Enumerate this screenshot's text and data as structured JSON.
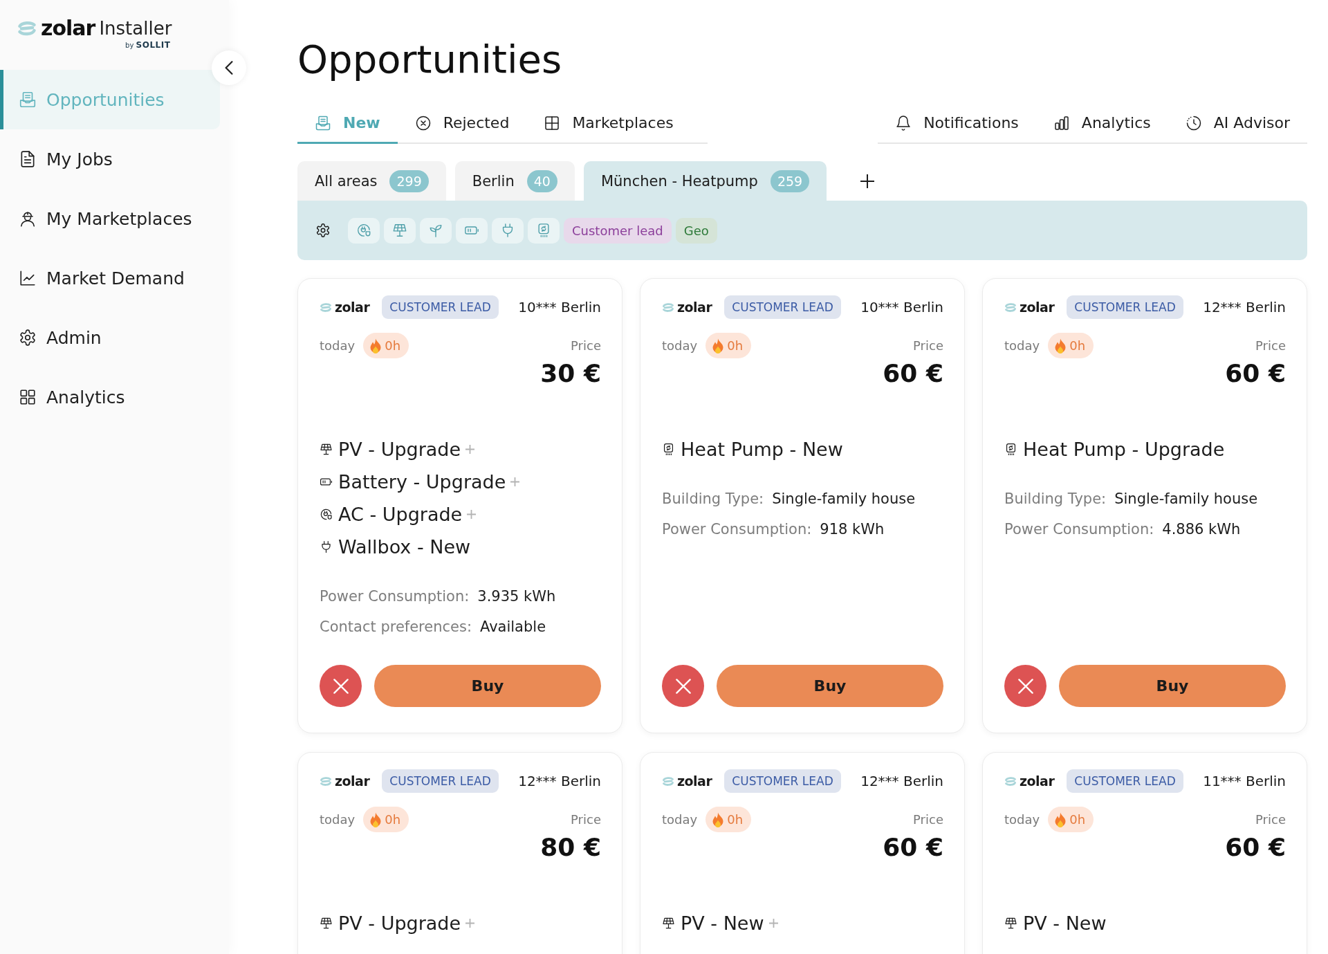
{
  "sidebar": {
    "logo": {
      "brand": "zolar",
      "product": "Installer",
      "byline": "by **SOLLIT**"
    },
    "items": [
      {
        "label": "Opportunities",
        "kind": "opportunities",
        "selected": true
      },
      {
        "label": "My Jobs",
        "kind": "jobs",
        "selected": false
      },
      {
        "label": "My Marketplaces",
        "kind": "marketplaces",
        "selected": false
      },
      {
        "label": "Market Demand",
        "kind": "demand",
        "selected": false
      },
      {
        "label": "Admin",
        "kind": "admin",
        "selected": false
      },
      {
        "label": "Analytics",
        "kind": "analytics",
        "selected": false
      }
    ]
  },
  "title": "Opportunities",
  "view_tabs": [
    {
      "label": "New",
      "kind": "new",
      "selected": true
    },
    {
      "label": "Rejected",
      "kind": "rejected",
      "selected": false
    },
    {
      "label": "Marketplaces",
      "kind": "marketplaces",
      "selected": false
    }
  ],
  "tool_tabs": [
    {
      "label": "Notifications",
      "kind": "notifications"
    },
    {
      "label": "Analytics",
      "kind": "analytics"
    },
    {
      "label": "AI Advisor",
      "kind": "advisor"
    }
  ],
  "area_tabs": [
    {
      "label": "All areas",
      "count": "299",
      "selected": false
    },
    {
      "label": "Berlin",
      "count": "40",
      "selected": false
    },
    {
      "label": "München - Heatpump",
      "count": "259",
      "selected": true
    }
  ],
  "filters": {
    "products": [
      {
        "kind": "ac"
      },
      {
        "kind": "pv"
      },
      {
        "kind": "plant"
      },
      {
        "kind": "battery"
      },
      {
        "kind": "wallbox"
      },
      {
        "kind": "heatpump"
      }
    ],
    "tags": [
      {
        "label": "Customer lead",
        "color": "#8c3f9b"
      },
      {
        "label": "Geo",
        "color": "#2e7a39"
      }
    ]
  },
  "cards": [
    {
      "source": "zolar",
      "lead_type": "CUSTOMER LEAD",
      "location": "10*** Berlin",
      "date": "today",
      "age": "0h",
      "price_label": "Price",
      "price": "30 €",
      "products": [
        {
          "kind": "pv",
          "label": "PV - Upgrade",
          "more": true
        },
        {
          "kind": "battery",
          "label": "Battery - Upgrade",
          "more": true
        },
        {
          "kind": "ac",
          "label": "AC - Upgrade",
          "more": true
        },
        {
          "kind": "wallbox",
          "label": "Wallbox - New",
          "more": false
        }
      ],
      "details": [
        {
          "label": "Power Consumption:",
          "value": "3.935 kWh"
        },
        {
          "label": "Contact preferences:",
          "value": "Available"
        }
      ],
      "actions": {
        "buy": "Buy"
      }
    },
    {
      "source": "zolar",
      "lead_type": "CUSTOMER LEAD",
      "location": "10*** Berlin",
      "date": "today",
      "age": "0h",
      "price_label": "Price",
      "price": "60 €",
      "products": [
        {
          "kind": "heatpump",
          "label": "Heat Pump - New",
          "more": false
        }
      ],
      "details": [
        {
          "label": "Building Type:",
          "value": "Single-family house"
        },
        {
          "label": "Power Consumption:",
          "value": "918 kWh"
        }
      ],
      "actions": {
        "buy": "Buy"
      }
    },
    {
      "source": "zolar",
      "lead_type": "CUSTOMER LEAD",
      "location": "12*** Berlin",
      "date": "today",
      "age": "0h",
      "price_label": "Price",
      "price": "60 €",
      "products": [
        {
          "kind": "heatpump",
          "label": "Heat Pump - Upgrade",
          "more": false
        }
      ],
      "details": [
        {
          "label": "Building Type:",
          "value": "Single-family house"
        },
        {
          "label": "Power Consumption:",
          "value": "4.886 kWh"
        }
      ],
      "actions": {
        "buy": "Buy"
      }
    },
    {
      "source": "zolar",
      "lead_type": "CUSTOMER LEAD",
      "location": "12*** Berlin",
      "date": "today",
      "age": "0h",
      "price_label": "Price",
      "price": "80 €",
      "products": [
        {
          "kind": "pv",
          "label": "PV - Upgrade",
          "more": true
        }
      ]
    },
    {
      "source": "zolar",
      "lead_type": "CUSTOMER LEAD",
      "location": "12*** Berlin",
      "date": "today",
      "age": "0h",
      "price_label": "Price",
      "price": "60 €",
      "products": [
        {
          "kind": "pv",
          "label": "PV - New",
          "more": true
        }
      ]
    },
    {
      "source": "zolar",
      "lead_type": "CUSTOMER LEAD",
      "location": "11*** Berlin",
      "date": "today",
      "age": "0h",
      "price_label": "Price",
      "price": "60 €",
      "products": [
        {
          "kind": "pv",
          "label": "PV - New",
          "more": false
        }
      ]
    }
  ]
}
